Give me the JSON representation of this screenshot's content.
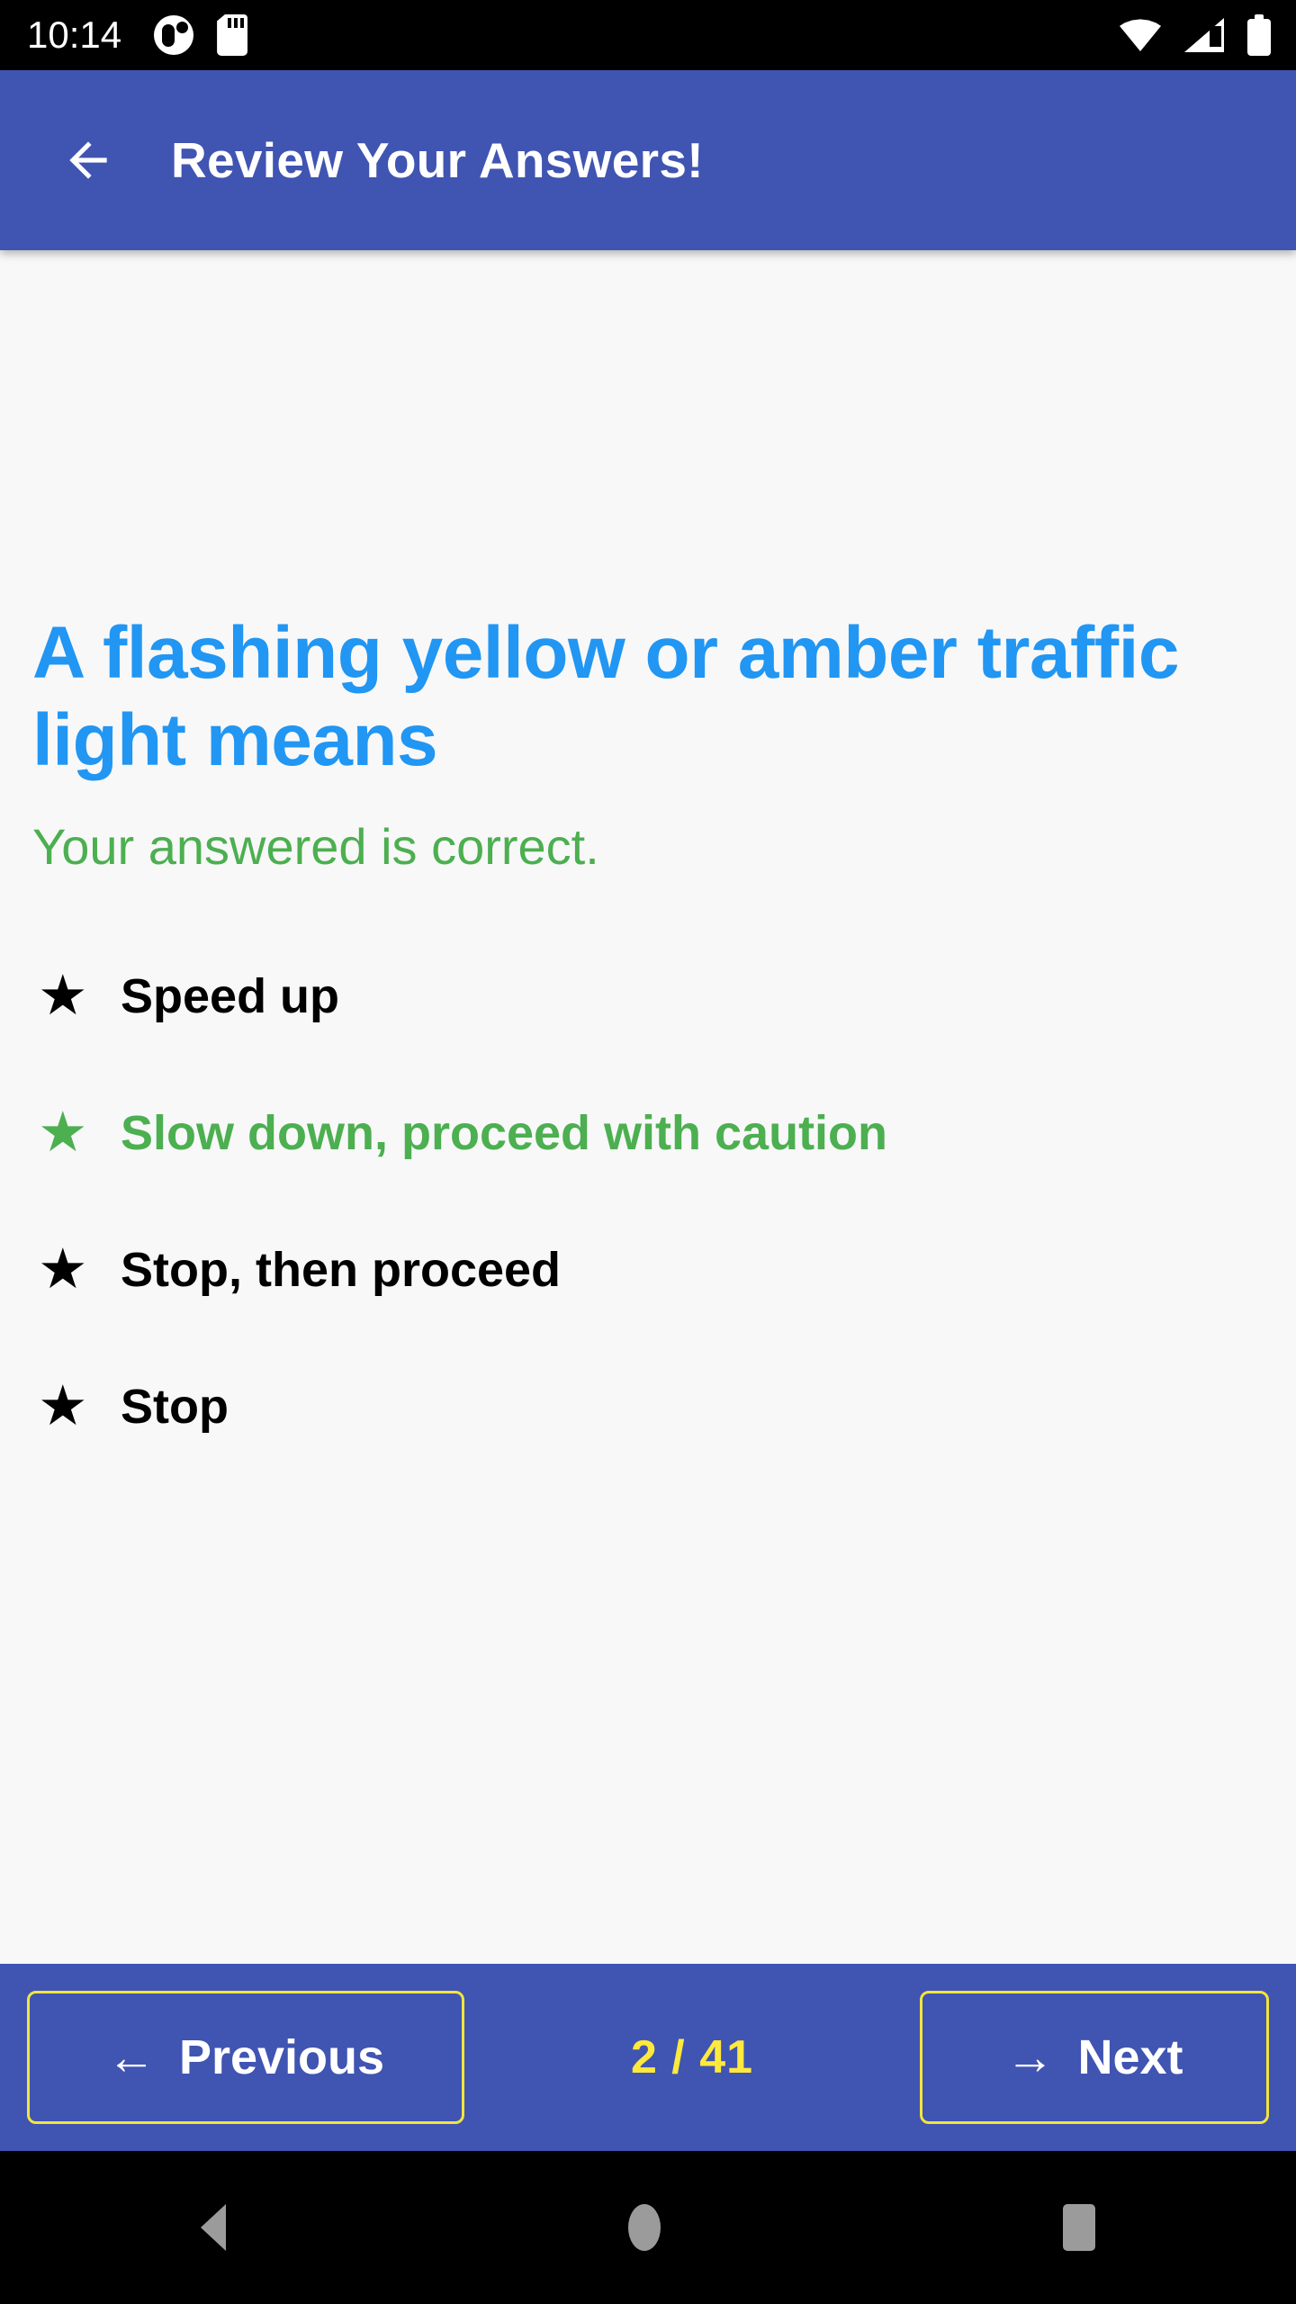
{
  "status_bar": {
    "time": "10:14",
    "left_icons": [
      "notification-circle-icon",
      "sd-card-icon"
    ],
    "right_icons": [
      "wifi-icon",
      "cellular-signal-icon",
      "battery-icon"
    ]
  },
  "app_bar": {
    "back_icon": "arrow-left-icon",
    "title": "Review Your Answers!",
    "background_color": "#4054b2",
    "title_color": "#ffffff"
  },
  "content": {
    "question": "A flashing yellow or amber traffic light means",
    "question_color": "#2196f3",
    "verdict": "Your answered is correct.",
    "verdict_color": "#4caf50",
    "background_color": "#f8f8f8",
    "options": [
      {
        "label": "Speed up",
        "bullet": "★",
        "state": "normal",
        "color": "#000000"
      },
      {
        "label": "Slow down, proceed with caution",
        "bullet": "★",
        "state": "correct",
        "color": "#4caf50"
      },
      {
        "label": "Stop, then proceed",
        "bullet": "★",
        "state": "normal",
        "color": "#000000"
      },
      {
        "label": "Stop",
        "bullet": "★",
        "state": "normal",
        "color": "#000000"
      }
    ]
  },
  "bottom_bar": {
    "background_color": "#4054b2",
    "border_color": "#f2e53d",
    "previous": {
      "label": "Previous",
      "glyph": "←"
    },
    "next": {
      "label": "Next",
      "glyph": "→"
    },
    "counter": "2 / 41",
    "counter_color": "#ffe93d"
  },
  "android_nav": {
    "back": "nav-back-triangle-icon",
    "home": "nav-home-circle-icon",
    "recents": "nav-recents-square-icon",
    "icon_color": "#9b9b9b"
  }
}
